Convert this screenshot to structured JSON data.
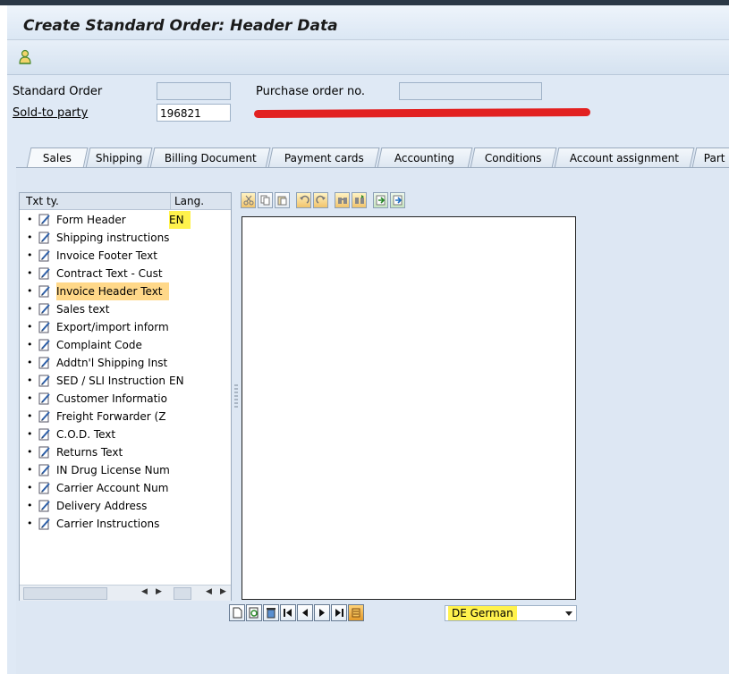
{
  "window": {
    "title": "Create Standard Order: Header Data"
  },
  "header_fields": {
    "standard_order_label": "Standard Order",
    "standard_order_value": "",
    "purchase_order_label": "Purchase order no.",
    "purchase_order_value": "",
    "sold_to_label": "Sold-to party",
    "sold_to_value": "196821"
  },
  "tabs": [
    {
      "label": "Sales"
    },
    {
      "label": "Shipping"
    },
    {
      "label": "Billing Document"
    },
    {
      "label": "Payment cards"
    },
    {
      "label": "Accounting"
    },
    {
      "label": "Conditions"
    },
    {
      "label": "Account assignment"
    },
    {
      "label": "Part"
    }
  ],
  "text_list": {
    "col_text_type": "Txt ty.",
    "col_language": "Lang.",
    "rows": [
      {
        "text": "Form Header",
        "lang": "EN",
        "lang_highlight": true
      },
      {
        "text": "Shipping instructions",
        "lang": ""
      },
      {
        "text": "Invoice Footer Text",
        "lang": ""
      },
      {
        "text": "Contract Text - Cust",
        "lang": ""
      },
      {
        "text": "Invoice Header Text",
        "lang": "",
        "selected": true
      },
      {
        "text": "Sales text",
        "lang": ""
      },
      {
        "text": "Export/import inform",
        "lang": ""
      },
      {
        "text": "Complaint Code",
        "lang": ""
      },
      {
        "text": "Addtn'l Shipping Inst",
        "lang": ""
      },
      {
        "text": "SED / SLI Instruction",
        "lang": "EN"
      },
      {
        "text": "Customer Informatio",
        "lang": ""
      },
      {
        "text": "Freight Forwarder (Z",
        "lang": ""
      },
      {
        "text": "C.O.D. Text",
        "lang": ""
      },
      {
        "text": "Returns Text",
        "lang": ""
      },
      {
        "text": "IN Drug License Num",
        "lang": ""
      },
      {
        "text": "Carrier Account Num",
        "lang": ""
      },
      {
        "text": "Delivery Address",
        "lang": ""
      },
      {
        "text": "Carrier Instructions",
        "lang": ""
      }
    ]
  },
  "editor": {
    "content": ""
  },
  "language_select": {
    "value": "DE German"
  },
  "colors": {
    "highlight_yellow": "#fff24d",
    "selected_orange": "#ffd889",
    "redaction": "#e22121"
  }
}
